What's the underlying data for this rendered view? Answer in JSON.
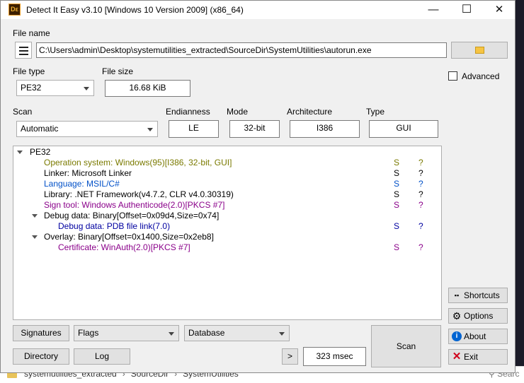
{
  "window": {
    "title": "Detect It Easy v3.10 [Windows 10 Version 2009] (x86_64)",
    "icon_text": "Dε",
    "minimize": "—",
    "maximize": "☐",
    "close": "✕"
  },
  "file": {
    "label": "File name",
    "path": "C:\\Users\\admin\\Desktop\\systemutilities_extracted\\SourceDir\\SystemUtilities\\autorun.exe"
  },
  "file_type": {
    "label": "File type",
    "value": "PE32"
  },
  "file_size": {
    "label": "File size",
    "value": "16.68 KiB"
  },
  "scan_mode": {
    "label": "Scan",
    "value": "Automatic"
  },
  "endianness": {
    "label": "Endianness",
    "value": "LE"
  },
  "mode": {
    "label": "Mode",
    "value": "32-bit"
  },
  "architecture": {
    "label": "Architecture",
    "value": "I386"
  },
  "type": {
    "label": "Type",
    "value": "GUI"
  },
  "advanced": {
    "label": "Advanced",
    "checked": false
  },
  "results": {
    "root": "PE32",
    "rows": [
      {
        "text": "Operation system: Windows(95)[I386, 32-bit, GUI]",
        "s": "S",
        "q": "?",
        "color": "#7a7a00"
      },
      {
        "text": "Linker: Microsoft Linker",
        "s": "S",
        "q": "?",
        "color": "#000000"
      },
      {
        "text": "Language: MSIL/C#",
        "s": "S",
        "q": "?",
        "color": "#0050c8"
      },
      {
        "text": "Library: .NET Framework(v4.7.2, CLR v4.0.30319)",
        "s": "S",
        "q": "?",
        "color": "#000000"
      },
      {
        "text": "Sign tool: Windows Authenticode(2.0)[PKCS #7]",
        "s": "S",
        "q": "?",
        "color": "#8a008a"
      },
      {
        "text": "Debug data: Binary[Offset=0x09d4,Size=0x74]",
        "s": "",
        "q": "",
        "color": "#000000"
      },
      {
        "text": "Debug data: PDB file link(7.0)",
        "s": "S",
        "q": "?",
        "color": "#0000a0"
      },
      {
        "text": "Overlay: Binary[Offset=0x1400,Size=0x2eb8]",
        "s": "",
        "q": "",
        "color": "#000000"
      },
      {
        "text": "Certificate: WinAuth(2.0)[PKCS #7]",
        "s": "S",
        "q": "?",
        "color": "#8a008a"
      }
    ]
  },
  "bottom": {
    "signatures": "Signatures",
    "flags": "Flags",
    "database": "Database",
    "directory": "Directory",
    "log": "Log",
    "next": ">",
    "time": "323 msec",
    "scan": "Scan"
  },
  "side": {
    "shortcuts": "Shortcuts",
    "options": "Options",
    "about": "About",
    "exit": "Exit"
  },
  "background": {
    "crumbs": [
      "systemutilities_extracted",
      "SourceDir",
      "SystemUtilities"
    ],
    "search": "Searc"
  },
  "colors": {
    "accent_about": "#0064d2",
    "exit_red": "#d0021b",
    "s_yellow": "#7a7a00",
    "s_blue": "#0050c8",
    "s_purple": "#8a008a"
  }
}
